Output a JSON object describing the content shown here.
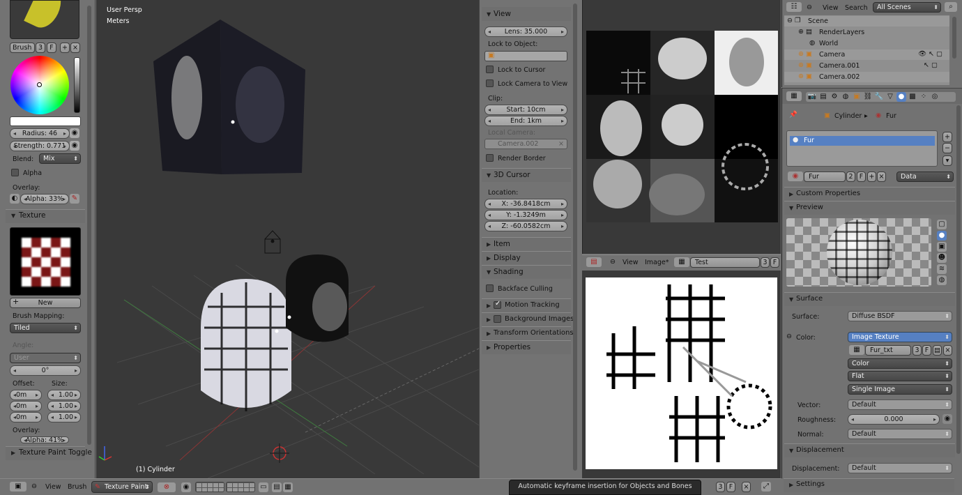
{
  "left_panel": {
    "brush_label": "Brush",
    "brush_users": "3",
    "brush_fake": "F",
    "radius": "Radius: 46",
    "strength": "Strength: 0.771",
    "blend_label": "Blend:",
    "blend_value": "Mix",
    "alpha_label": "Alpha",
    "overlay_label": "Overlay:",
    "overlay_alpha": "Alpha: 33%",
    "texture_header": "Texture",
    "new_button": "New",
    "brush_mapping_label": "Brush Mapping:",
    "brush_mapping_value": "Tiled",
    "angle_label": "Angle:",
    "angle_mode": "User",
    "angle_value": "0°",
    "offset_label": "Offset:",
    "size_label": "Size:",
    "offsets": [
      "0m",
      "0m",
      "0m"
    ],
    "sizes": [
      "1.00",
      "1.00",
      "1.00"
    ],
    "overlay2_label": "Overlay:",
    "overlay2_alpha": "Alpha: 41%",
    "texture_paint_toggle": "Texture Paint Toggle"
  },
  "viewport": {
    "view_name": "User Persp",
    "units": "Meters",
    "object_name": "(1) Cylinder"
  },
  "properties_n": {
    "view_header": "View",
    "lens": "Lens: 35.000",
    "lock_to_object": "Lock to Object:",
    "lock_to_cursor": "Lock to Cursor",
    "lock_camera": "Lock Camera to View",
    "clip_label": "Clip:",
    "clip_start": "Start: 10cm",
    "clip_end": "End: 1km",
    "local_camera_label": "Local Camera:",
    "local_camera_value": "Camera.002",
    "render_border": "Render Border",
    "cursor_header": "3D Cursor",
    "location_label": "Location:",
    "cursor_x": "X: -36.8418cm",
    "cursor_y": "Y: -1.3249m",
    "cursor_z": "Z: -60.0582cm",
    "item": "Item",
    "display": "Display",
    "shading": "Shading",
    "backface": "Backface Culling",
    "motion_tracking": "Motion Tracking",
    "background_images": "Background Images",
    "transform_orientations": "Transform Orientations",
    "properties": "Properties"
  },
  "image_editor": {
    "view": "View",
    "image_menu": "Image*",
    "image_name": "Test",
    "users": "3",
    "fake": "F"
  },
  "outliner": {
    "view": "View",
    "search": "Search",
    "scene_filter": "All Scenes",
    "items": [
      "Scene",
      "RenderLayers",
      "World",
      "Camera",
      "Camera.001",
      "Camera.002"
    ]
  },
  "material": {
    "breadcrumb_object": "Cylinder",
    "breadcrumb_material": "Fur",
    "slot_name": "Fur",
    "material_name": "Fur",
    "material_users": "2",
    "material_fake": "F",
    "link": "Data",
    "custom_properties": "Custom Properties",
    "preview": "Preview",
    "surface_header": "Surface",
    "surface_label": "Surface:",
    "surface_value": "Diffuse BSDF",
    "color_label": "Color:",
    "color_value": "Image Texture",
    "tex_name": "Fur_txt",
    "tex_users": "3",
    "tex_fake": "F",
    "color_mode": "Color",
    "projection": "Flat",
    "source": "Single Image",
    "vector_label": "Vector:",
    "vector_value": "Default",
    "roughness_label": "Roughness:",
    "roughness_value": "0.000",
    "normal_label": "Normal:",
    "normal_value": "Default",
    "displacement_header": "Displacement",
    "displacement_label": "Displacement:",
    "displacement_value": "Default",
    "settings": "Settings"
  },
  "bottom_bar": {
    "view": "View",
    "brush": "Brush",
    "mode": "Texture Paint",
    "tooltip": "Automatic keyframe insertion for Objects and Bones",
    "frame_users": "3",
    "frame_fake": "F"
  },
  "colors": {
    "selection": "#5680c2",
    "panel": "#727272",
    "viewport": "#393939",
    "header": "#727272"
  }
}
